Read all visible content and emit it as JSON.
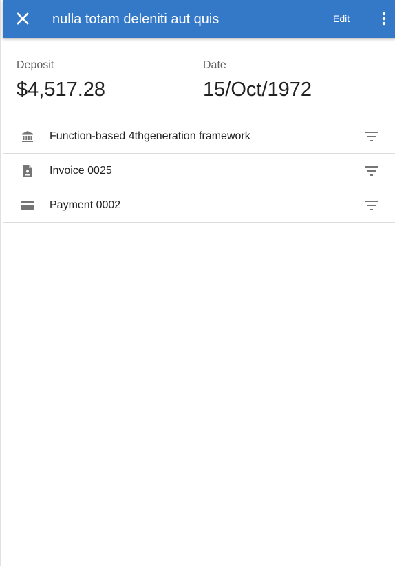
{
  "app_bar": {
    "title": "nulla totam deleniti aut quis",
    "edit_label": "Edit",
    "close_icon": "close-icon",
    "more_icon": "more-vert-icon",
    "color": "#3479c8"
  },
  "summary": {
    "deposit_label": "Deposit",
    "deposit_value": "$4,517.28",
    "date_label": "Date",
    "date_value": "15/Oct/1972"
  },
  "items": [
    {
      "icon": "bank-icon",
      "label": "Function-based 4thgeneration framework",
      "action_icon": "filter-icon"
    },
    {
      "icon": "invoice-icon",
      "label": "Invoice 0025",
      "action_icon": "filter-icon"
    },
    {
      "icon": "payment-card-icon",
      "label": "Payment 0002",
      "action_icon": "filter-icon"
    }
  ]
}
